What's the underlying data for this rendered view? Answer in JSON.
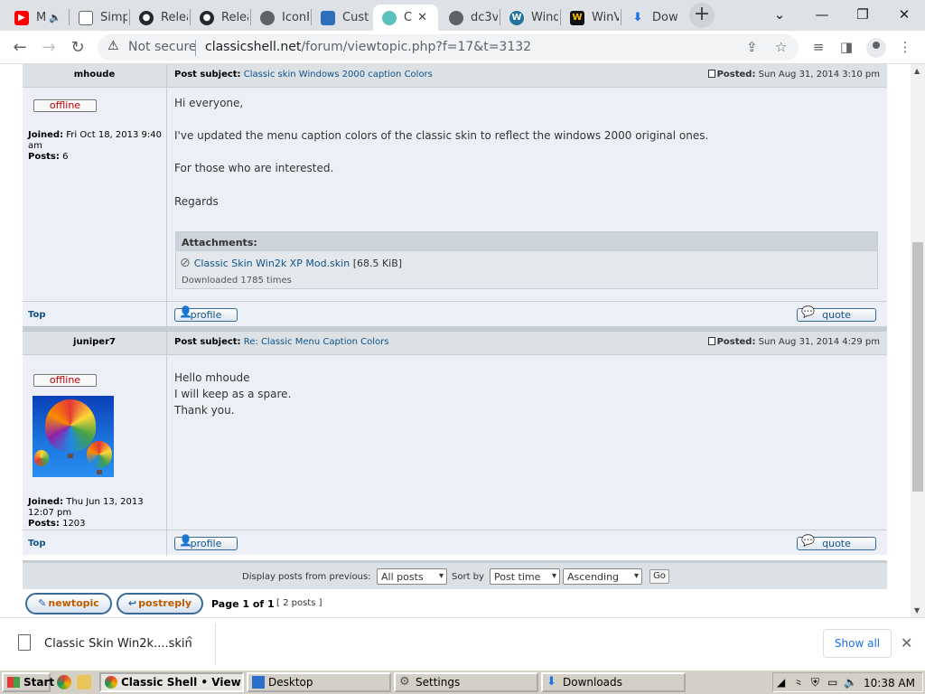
{
  "browser": {
    "tabs": [
      {
        "title": "M",
        "icon": "youtube-icon"
      },
      {
        "title": "Simp",
        "icon": "doc-icon"
      },
      {
        "title": "Relea",
        "icon": "github-icon"
      },
      {
        "title": "Relea",
        "icon": "github-icon"
      },
      {
        "title": "IconF",
        "icon": "globe-icon"
      },
      {
        "title": "Custo",
        "icon": "custom-icon"
      },
      {
        "title": "C",
        "icon": "classicshell-icon",
        "active": true
      },
      {
        "title": "dc3v",
        "icon": "globe-icon"
      },
      {
        "title": "Wind",
        "icon": "wordpress-icon"
      },
      {
        "title": "WinV",
        "icon": "w-icon"
      },
      {
        "title": "Dow",
        "icon": "download-icon"
      }
    ],
    "new_tab_label": "+",
    "not_secure_label": "Not secure",
    "url_host": "classicshell.net",
    "url_path": "/forum/viewtopic.php?f=17&t=3132"
  },
  "posts": [
    {
      "author": "mhoude",
      "status": "offline",
      "joined_label": "Joined:",
      "joined": "Fri Oct 18, 2013 9:40 am",
      "posts_label": "Posts:",
      "posts": "6",
      "subject_label": "Post subject:",
      "subject": "Classic skin Windows 2000 caption Colors",
      "posted_label": "Posted:",
      "posted": "Sun Aug 31, 2014 3:10 pm",
      "body": [
        "Hi everyone,",
        "I've updated the menu caption colors of the classic skin to reflect the windows 2000 original ones.",
        "For those who are interested.",
        "Regards"
      ],
      "attachments_label": "Attachments:",
      "attachment_name": "Classic Skin Win2k XP Mod.skin",
      "attachment_size": "[68.5 KiB]",
      "attachment_downloads": "Downloaded 1785 times"
    },
    {
      "author": "juniper7",
      "status": "offline",
      "joined_label": "Joined:",
      "joined": "Thu Jun 13, 2013 12:07 pm",
      "posts_label": "Posts:",
      "posts": "1203",
      "subject_label": "Post subject:",
      "subject": "Re: Classic Menu Caption Colors",
      "posted_label": "Posted:",
      "posted": "Sun Aug 31, 2014 4:29 pm",
      "body": [
        "Hello mhoude",
        "I will keep as a spare.",
        "Thank you."
      ]
    }
  ],
  "labels": {
    "top": "Top",
    "profile": "profile",
    "quote": "quote",
    "display_from": "Display posts from previous:",
    "sort_by": "Sort by",
    "go": "Go",
    "new_topic": "newtopic",
    "post_reply": "postreply",
    "page_of": "Page 1 of 1",
    "post_count": "[ 2 posts ]"
  },
  "selects": {
    "previous": "All posts",
    "sort_key": "Post time",
    "sort_dir": "Ascending"
  },
  "download_shelf": {
    "file": "Classic Skin Win2k....skin",
    "show_all": "Show all"
  },
  "taskbar": {
    "start": "Start",
    "items": [
      {
        "label": "Classic Shell • View t...",
        "active": true
      },
      {
        "label": "Desktop"
      },
      {
        "label": "Settings"
      },
      {
        "label": "Downloads"
      }
    ],
    "clock": "10:38 AM"
  },
  "colors": {
    "link": "#105289",
    "post_bg": "#ecf0f6",
    "header_bg": "#dce1e5",
    "offline": "#c00000",
    "chrome_accent": "#1a73e8"
  }
}
